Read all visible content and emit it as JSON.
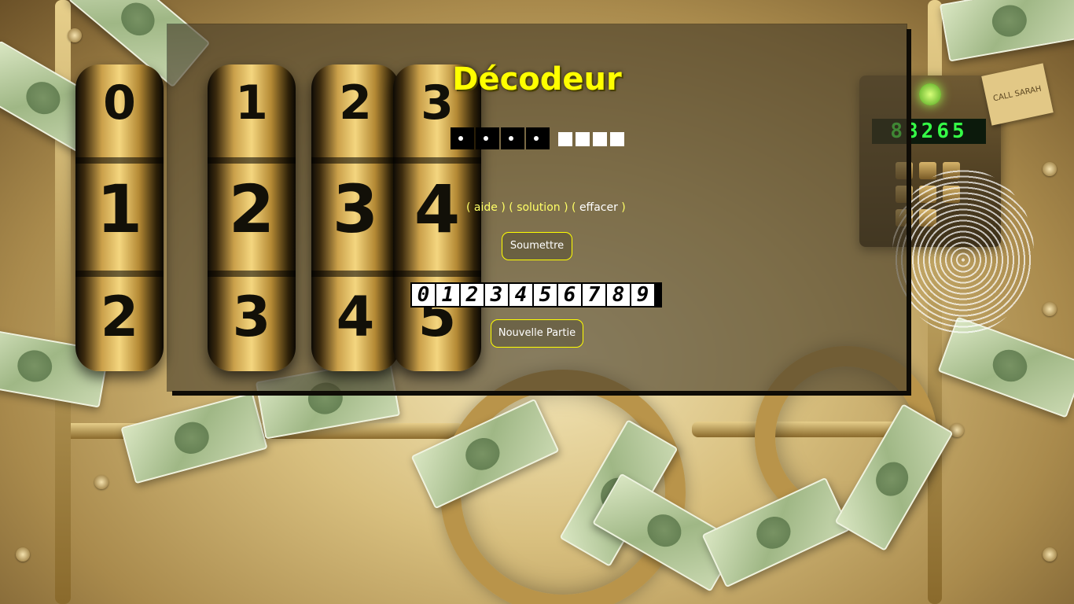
{
  "header": {
    "title": "Décodeur"
  },
  "code_slots": {
    "filled": [
      "•",
      "•",
      "•",
      "•"
    ],
    "empty_count": 4
  },
  "actions": {
    "open_paren": "(",
    "close_paren": ")",
    "aide": "aide",
    "solution": "solution",
    "effacer": "effacer"
  },
  "buttons": {
    "submit": "Soumettre",
    "new_game": "Nouvelle Partie"
  },
  "digit_pad": [
    "0",
    "1",
    "2",
    "3",
    "4",
    "5",
    "6",
    "7",
    "8",
    "9"
  ],
  "decor": {
    "lock_drums": [
      {
        "top": "0",
        "mid": "1",
        "bottom": "2"
      },
      {
        "top": "1",
        "mid": "2",
        "bottom": "3"
      },
      {
        "top": "2",
        "mid": "3",
        "bottom": "4"
      },
      {
        "top": "3",
        "mid": "4",
        "bottom": "5"
      }
    ],
    "keypad_display": "88265",
    "note_text": "CALL SARAH"
  },
  "colors": {
    "accent": "#ffff00",
    "panel": "rgba(70,60,40,.62)",
    "button_border": "#ffff00"
  }
}
